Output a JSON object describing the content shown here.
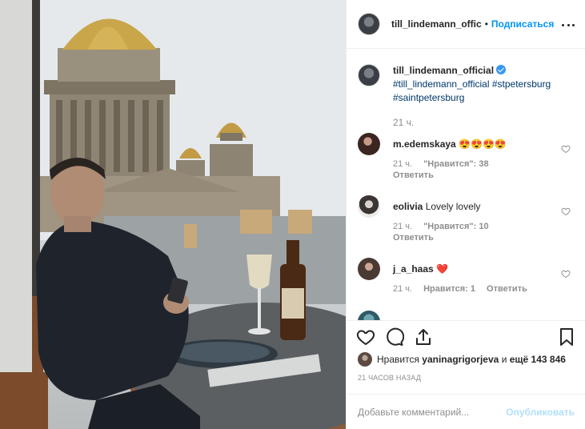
{
  "post": {
    "image_alt": "Till Lindemann at a restaurant table overlooking St. Isaac's Cathedral",
    "author": "till_lindemann_offic",
    "separator": "•",
    "follow_label": "Подписаться"
  },
  "caption": {
    "username": "till_lindemann_official",
    "hashtags": "#till_lindemann_official #stpetersburg #saintpetersburg",
    "time": "21 ч."
  },
  "comments": [
    {
      "username": "m.edemskaya",
      "text": "😍😍😍😍",
      "time": "21 ч.",
      "likes": "\"Нравится\": 38",
      "reply": "Ответить"
    },
    {
      "username": "eolivia",
      "text": "Lovely lovely",
      "time": "21 ч.",
      "likes": "\"Нравится\": 10",
      "reply": "Ответить"
    },
    {
      "username": "j_a_haas",
      "text": "❤️",
      "time": "21 ч.",
      "likes": "Нравится: 1",
      "reply": "Ответить"
    }
  ],
  "likes": {
    "prefix": "Нравится",
    "user": "yaninagrigorjeva",
    "middle": "и",
    "count": "ещё 143 846"
  },
  "timestamp": "21 ЧАСОВ НАЗАД",
  "comment_box": {
    "placeholder": "Добавьте комментарий...",
    "publish_label": "Опубликовать"
  },
  "colors": {
    "link": "#0095f6",
    "hashtag": "#00376b",
    "muted": "#8e8e8e",
    "publish_disabled": "#b2dffc"
  }
}
